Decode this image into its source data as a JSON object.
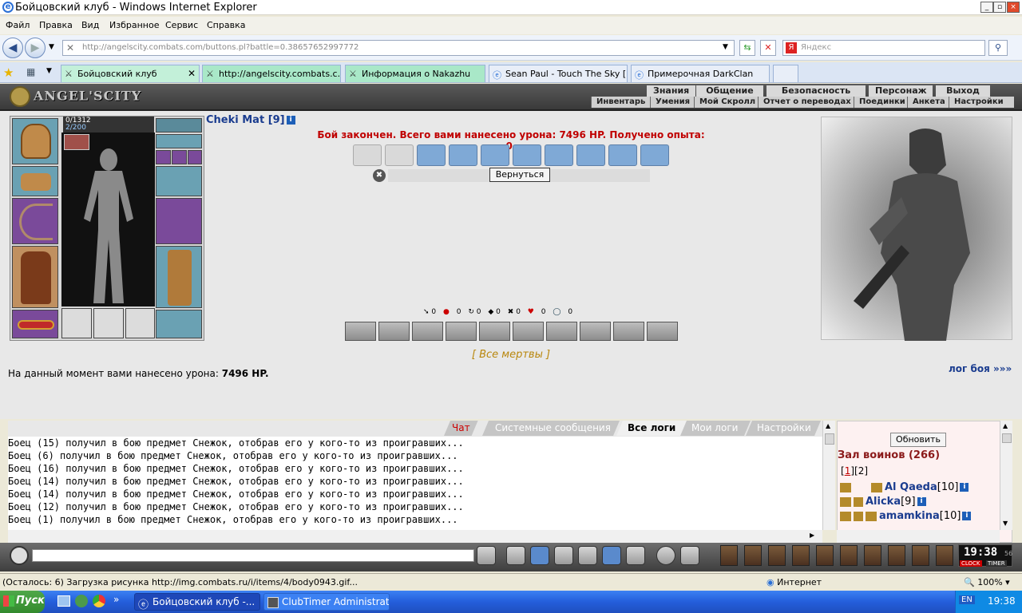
{
  "window": {
    "title": "Бойцовский клуб - Windows Internet Explorer",
    "controls": [
      "_",
      "▫",
      "×"
    ]
  },
  "menu": [
    "Файл",
    "Правка",
    "Вид",
    "Избранное",
    "Сервис",
    "Справка"
  ],
  "address": {
    "url_host": "http://angelscity.combats.com/buttons.pl?battle=0.38657652997772",
    "search_placeholder": "Яндекс"
  },
  "tabs": [
    "Бойцовский клуб",
    "http://angelscity.combats.c...",
    "Информация о Nakazhu",
    "Sean Paul - Touch The Sky [...",
    "Примерочная DarkClan"
  ],
  "game_header": {
    "logo": "ANGEL'SCITY",
    "nav_top": [
      "Знания",
      "Общение",
      "Безопасность",
      "Персонаж",
      "Выход"
    ],
    "nav_bottom": [
      "Инвентарь",
      "Умения",
      "Мой Скролл",
      "Отчет о переводах",
      "Поединки",
      "Анкета",
      "Настройки"
    ]
  },
  "character": {
    "hp": "0/1312",
    "mana": "2/200",
    "name": "Cheki Mat [9]",
    "info_icon": "i"
  },
  "battle": {
    "status": "Бой закончен. Всего вами нанесено урона: 7496 HP. Получено опыта: 0.",
    "return_button": "Вернуться",
    "badge": "✖",
    "stats": [
      "0",
      "0",
      "0",
      "0",
      "0",
      "0",
      "0"
    ],
    "all_dead": "[ Все мертвы ]",
    "damage_label": "На данный момент вами нанесено урона:",
    "damage_value": "7496 HP.",
    "log_link": "лог боя »»»"
  },
  "chat": {
    "tabs": [
      "Чат",
      "Системные сообщения",
      "Все логи",
      "Мои логи",
      "Настройки"
    ],
    "messages": [
      "Боец (15) получил в бою предмет Снежок, отобрав его у кого-то из проигравших...",
      "Боец (6) получил в бою предмет Снежок, отобрав его у кого-то из проигравших...",
      "Боец (16) получил в бою предмет Снежок, отобрав его у кого-то из проигравших...",
      "Боец (14) получил в бою предмет Снежок, отобрав его у кого-то из проигравших...",
      "Боец (14) получил в бою предмет Снежок, отобрав его у кого-то из проигравших...",
      "Боец (12) получил в бою предмет Снежок, отобрав его у кого-то из проигравших...",
      "Боец (1) получил в бою предмет Снежок, отобрав его у кого-то из проигравших..."
    ]
  },
  "sidebar": {
    "refresh": "Обновить",
    "hall_title": "Зал воинов (266)",
    "page1": "1",
    "page2": "2",
    "warriors": [
      {
        "name": "Al Qaeda",
        "level": "[10]"
      },
      {
        "name": "Alicka",
        "level": "[9]"
      },
      {
        "name": "amamkina",
        "level": "[10]"
      }
    ]
  },
  "clock": {
    "time": "19:38",
    "sec": "56",
    "left": "CLOCK",
    "right": "TIMER"
  },
  "ie_status": {
    "message": "(Осталось: 6) Загрузка рисунка http://img.combats.ru/i/items/4/body0943.gif...",
    "zone": "Интернет",
    "zoom": "100%"
  },
  "taskbar": {
    "start": "Пуск",
    "items": [
      "Бойцовский клуб -...",
      "ClubTimer Administrat..."
    ],
    "lang": "EN",
    "time": "19:38"
  }
}
